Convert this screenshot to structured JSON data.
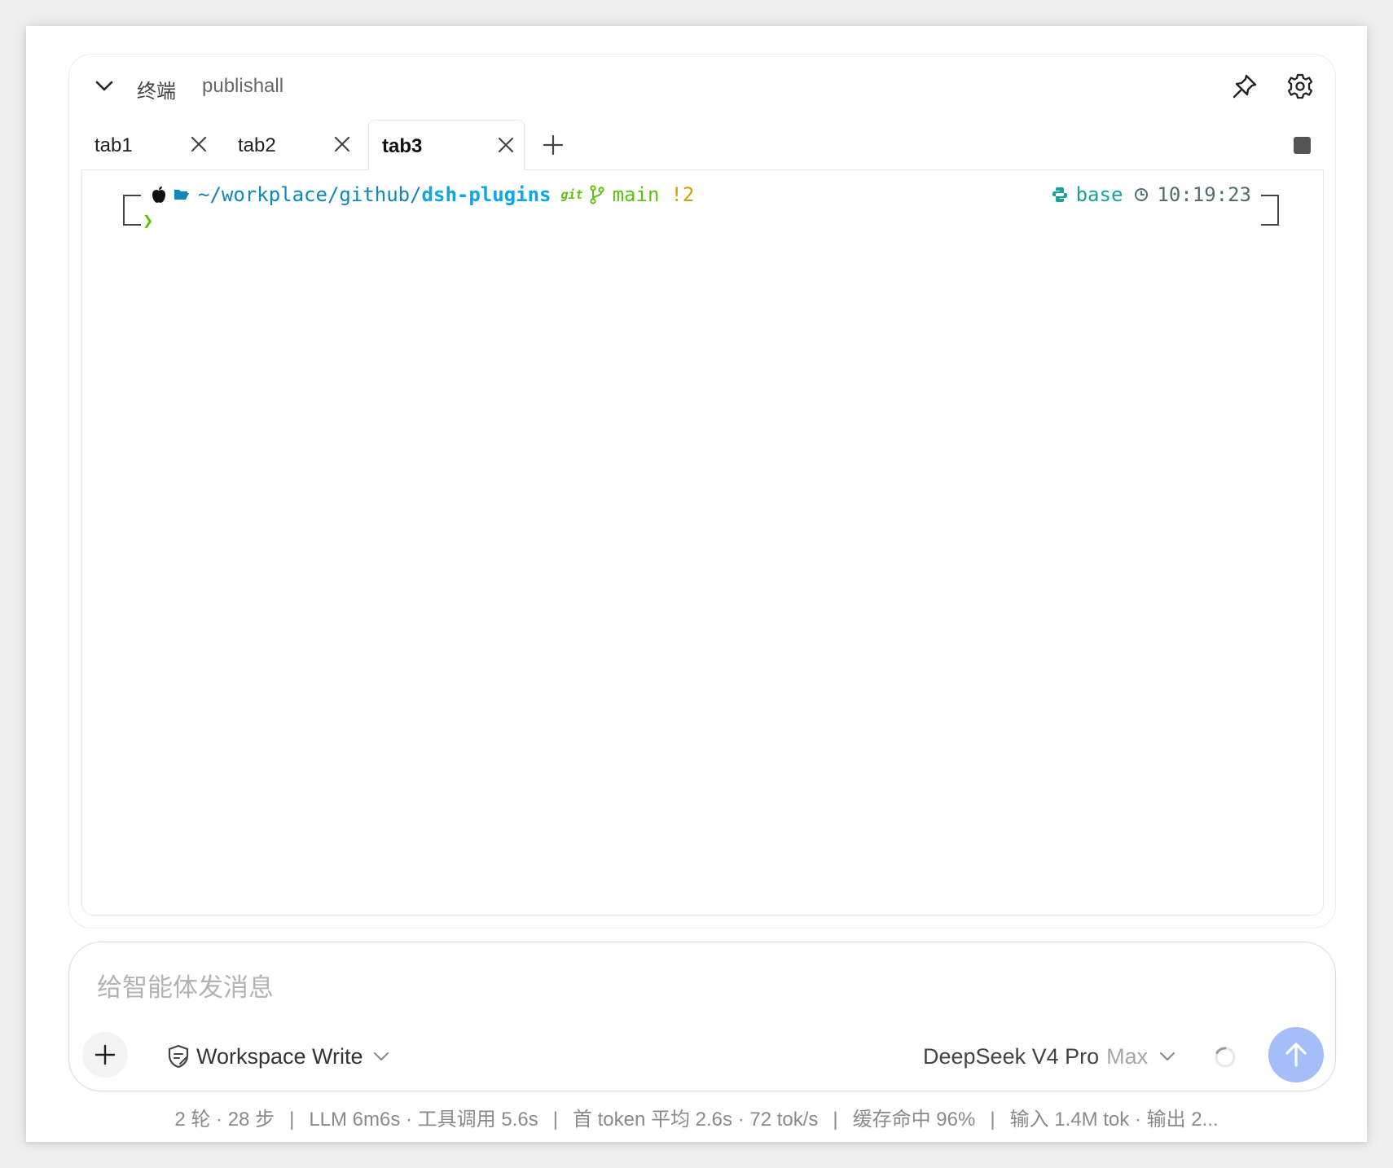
{
  "header": {
    "title": "终端",
    "subtitle": "publishall"
  },
  "tabs": [
    {
      "label": "tab1",
      "active": false
    },
    {
      "label": "tab2",
      "active": false
    },
    {
      "label": "tab3",
      "active": true
    }
  ],
  "terminal": {
    "path_prefix": "~/workplace/github/",
    "path_dir": "dsh-plugins",
    "git_label": "git",
    "branch": "main",
    "git_status": "!2",
    "env_name": "base",
    "time": "10:19:23",
    "prompt_char": "❯"
  },
  "composer": {
    "placeholder": "给智能体发消息",
    "mode_label": "Workspace Write",
    "model_name": "DeepSeek V4 Pro",
    "model_variant": "Max"
  },
  "status": {
    "rounds": "2 轮 · 28 步",
    "llm": "LLM 6m6s · 工具调用 5.6s",
    "first_token": "首 token 平均 2.6s · 72 tok/s",
    "cache": "缓存命中 96%",
    "io": "输入 1.4M tok · 输出 2..."
  },
  "colors": {
    "path": "#0f86b8",
    "path_bold": "#0aa6e8",
    "git_green": "#5cc30a",
    "git_status": "#d0a000",
    "env": "#16a39d",
    "time": "#4f6e6e",
    "send_button": "#a4bef8"
  }
}
